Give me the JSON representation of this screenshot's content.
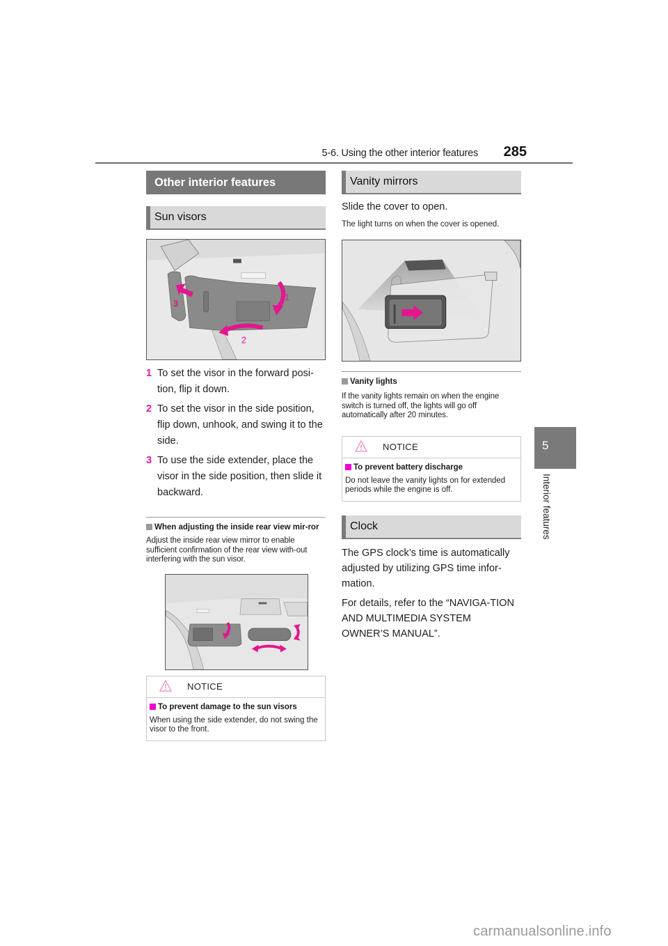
{
  "header": {
    "section_title": "5-6. Using the other interior features",
    "page_number": "285"
  },
  "chapter_tab": {
    "number": "5",
    "label": "Interior features"
  },
  "left_column": {
    "main_heading": "Other interior features",
    "sun_visors": {
      "heading": "Sun visors",
      "figure": {
        "icon": "sun-visor-illustration",
        "callouts": [
          "1",
          "2",
          "3"
        ]
      },
      "steps": [
        {
          "num": "1",
          "text": "To set the visor in the forward posi-tion, flip it down."
        },
        {
          "num": "2",
          "text": "To set the visor in the side position, flip down, unhook, and swing it to the side."
        },
        {
          "num": "3",
          "text": "To use the side extender, place the visor in the side position, then slide it backward."
        }
      ]
    },
    "rear_view_note": {
      "title": "When adjusting the inside rear view mir-ror",
      "text": "Adjust the inside rear view mirror to enable sufficient confirmation of the rear view with-out interfering with the sun visor.",
      "figure": {
        "icon": "rear-view-mirror-illustration"
      }
    },
    "notice": {
      "label": "NOTICE",
      "title": "To prevent damage to the sun visors",
      "text": "When using the side extender, do not swing the visor to the front."
    }
  },
  "right_column": {
    "vanity_mirrors": {
      "heading": "Vanity mirrors",
      "intro": "Slide the cover to open.",
      "sub": "The light turns on when the cover is opened.",
      "figure": {
        "icon": "vanity-mirror-illustration"
      }
    },
    "vanity_lights_note": {
      "title": "Vanity lights",
      "text": "If the vanity lights remain on when the engine switch is turned off, the lights will go off automatically after 20 minutes."
    },
    "notice": {
      "label": "NOTICE",
      "title": "To prevent battery discharge",
      "text": "Do not leave the vanity lights on for extended periods while the engine is off."
    },
    "clock": {
      "heading": "Clock",
      "p1": "The GPS clock’s time is automatically adjusted by utilizing GPS time infor-mation.",
      "p2": "For details, refer to the “NAVIGA-TION AND MULTIMEDIA SYSTEM OWNER’S MANUAL”."
    }
  },
  "colors": {
    "accent_magenta": "#d61a9c",
    "notice_square": "#ec00d8",
    "heading_gray": "#787878",
    "subheading_bg": "#d9d9d9"
  },
  "watermark": "carmanualsonline.info"
}
